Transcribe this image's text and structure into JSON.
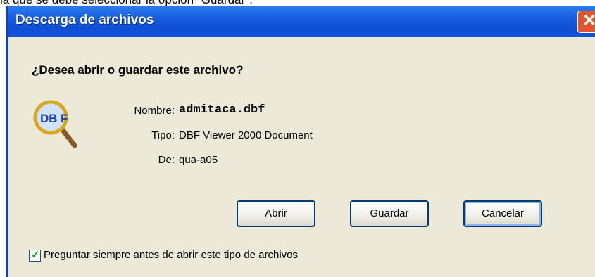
{
  "caption": "la que se debe seleccionar la opción \"Guardar\".",
  "dialog": {
    "title": "Descarga de archivos",
    "close_icon": "close-icon",
    "question": "¿Desea abrir o guardar este archivo?",
    "file_icon": "dbf-magnifier-icon",
    "fields": {
      "nombre_label": "Nombre:",
      "nombre_value": "admitaca.dbf",
      "tipo_label": "Tipo:",
      "tipo_value": "DBF Viewer 2000 Document",
      "de_label": "De:",
      "de_value": "qua-a05"
    },
    "buttons": {
      "open": "Abrir",
      "save": "Guardar",
      "cancel": "Cancelar"
    },
    "checkbox": {
      "label": "Preguntar siempre antes de abrir este tipo de archivos",
      "checked": true
    }
  },
  "colors": {
    "titlebar": "#0f4fd4",
    "dialog_bg": "#ece9d8",
    "close_button": "#e0552c"
  }
}
